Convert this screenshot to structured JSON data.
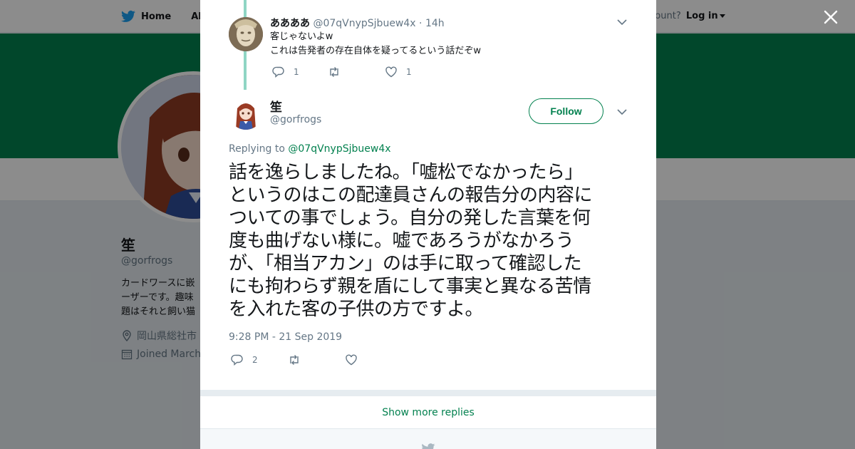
{
  "background": {
    "nav": {
      "home_label": "Home",
      "about_label": "Abo",
      "account_prompt": "ccount?",
      "login_label": "Log in"
    },
    "profile": {
      "name": "笙",
      "handle": "@gorfrogs",
      "bio": [
        "カードワースに嵌",
        "ーザーです。趣味",
        "題はそれと飼い猫"
      ],
      "location": "岡山県総社市",
      "joined": "Joined March"
    },
    "colors": {
      "banner": "#03814f",
      "dim": "rgba(0,0,0,0.45)"
    }
  },
  "modal": {
    "close_icon": "close-icon",
    "parent_reply": {
      "name": "ああああ",
      "handle": "@07qVnypSjbuew4x",
      "separator": "·",
      "time": "14h",
      "text_lines": [
        "客じゃないよw",
        "これは告発者の存在自体を疑ってるという話だぞw"
      ],
      "reply_count": "1",
      "retweet_count": "",
      "like_count": "1"
    },
    "main_tweet": {
      "name": "笙",
      "handle": "@gorfrogs",
      "follow_label": "Follow",
      "replying_prefix": "Replying to",
      "replying_to": "@07qVnypSjbuew4x",
      "text_lines": [
        "話を逸らしましたね。「嘘松でなかったら」",
        "というのはこの配達員さんの報告分の内容に",
        "ついての事でしょう。自分の発した言葉を何",
        "度も曲げない様に。嘘であろうがなかろう",
        "が、「相当アカン」のは手に取って確認した",
        "にも拘わらず親を盾にして事実と異なる苦情",
        "を入れた客の子供の方ですよ。"
      ],
      "timestamp": "9:28 PM - 21 Sep 2019",
      "reply_count": "2",
      "retweet_count": "",
      "like_count": ""
    },
    "show_more_label": "Show more replies",
    "accent_color": "#03814f",
    "thread_line_color": "#8fd5c4"
  }
}
